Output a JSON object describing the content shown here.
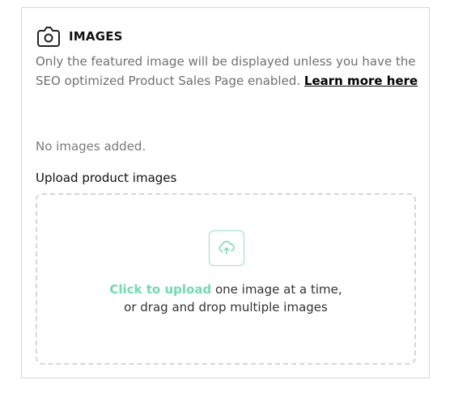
{
  "section": {
    "title": "IMAGES",
    "icon": "camera-icon",
    "description_text": "Only the featured image will be displayed unless you have the SEO optimized Product Sales Page enabled.",
    "learn_more_label": "Learn more here",
    "empty_state": "No images added.",
    "upload_label": "Upload product images"
  },
  "dropzone": {
    "icon": "cloud-upload-icon",
    "click_label": "Click to upload",
    "line1_rest": "one image at a time,",
    "line2": "or drag and drop multiple images",
    "accent_color": "#6fdcae"
  }
}
